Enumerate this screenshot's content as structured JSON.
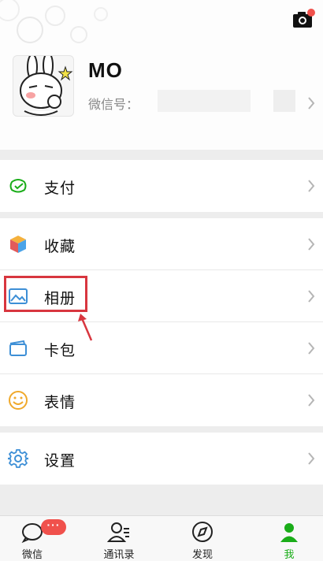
{
  "profile": {
    "nickname": "MO",
    "wechat_id_label": "微信号："
  },
  "menu": {
    "pay": "支付",
    "favorites": "收藏",
    "album": "相册",
    "cards": "卡包",
    "stickers": "表情",
    "settings": "设置"
  },
  "tabbar": {
    "chats": "微信",
    "chats_badge": "···",
    "contacts": "通讯录",
    "discover": "发现",
    "me": "我"
  },
  "colors": {
    "accent_green": "#1aad19",
    "badge_red": "#f0514c",
    "highlight_red": "#d8363f"
  },
  "icons": {
    "camera": "camera-icon",
    "pay": "wallet-icon",
    "favorites": "cube-icon",
    "album": "image-icon",
    "cards": "card-icon",
    "stickers": "smile-icon",
    "settings": "gear-icon"
  }
}
